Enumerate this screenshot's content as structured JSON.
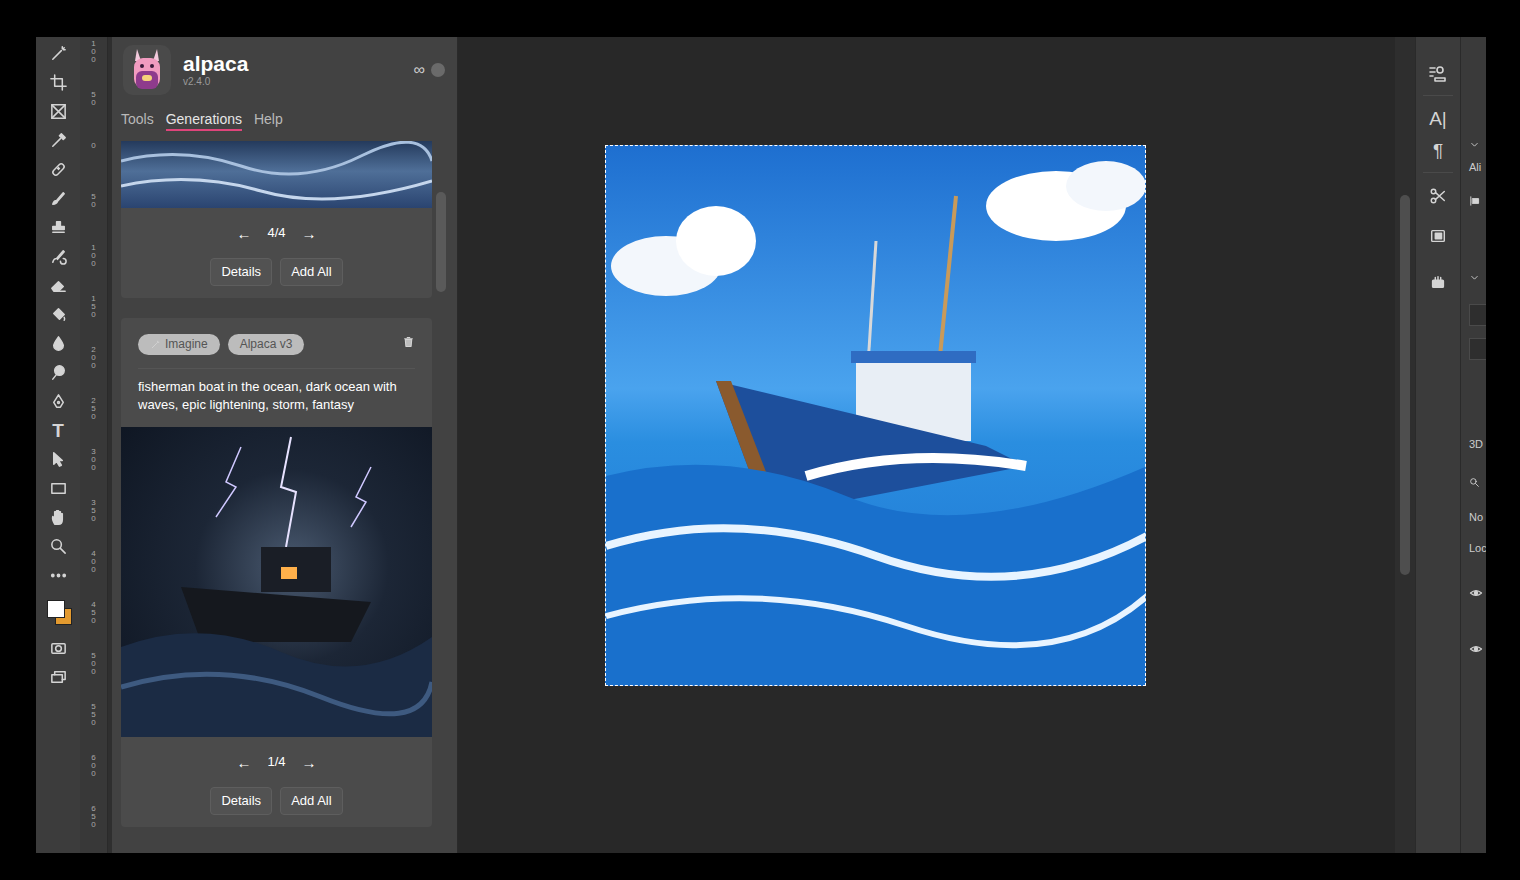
{
  "plugin": {
    "name": "alpaca",
    "version": "v2.4.0",
    "link_icon": "∞"
  },
  "tabs": [
    {
      "label": "Tools",
      "selected": false
    },
    {
      "label": "Generations",
      "selected": true
    },
    {
      "label": "Help",
      "selected": false
    }
  ],
  "generations": [
    {
      "tags": [],
      "prompt": "",
      "prev": "←",
      "counter": "4/4",
      "next": "→",
      "buttons": [
        "Details",
        "Add All"
      ],
      "image": "ocean"
    },
    {
      "tags": [
        "Imagine",
        "Alpaca v3"
      ],
      "prompt": "fisherman boat in the ocean, dark ocean with waves, epic lightening, storm, fantasy",
      "prev": "←",
      "counter": "1/4",
      "next": "→",
      "buttons": [
        "Details",
        "Add All"
      ],
      "image": "storm"
    }
  ],
  "ruler": {
    "ticks": [
      "100",
      "50",
      "0",
      "50",
      "100",
      "150",
      "200",
      "250",
      "300",
      "350",
      "400",
      "450",
      "500",
      "550",
      "600",
      "650"
    ]
  },
  "toolbar": {
    "tools": [
      {
        "kind": "wand"
      },
      {
        "kind": "crop"
      },
      {
        "kind": "frame"
      },
      {
        "kind": "eyedropper"
      },
      {
        "kind": "healing"
      },
      {
        "kind": "brush"
      },
      {
        "kind": "stamp"
      },
      {
        "kind": "history"
      },
      {
        "kind": "eraser"
      },
      {
        "kind": "bucket"
      },
      {
        "kind": "drop"
      },
      {
        "kind": "dodge"
      },
      {
        "kind": "pen"
      },
      {
        "kind": "type",
        "label": "T"
      },
      {
        "kind": "select"
      },
      {
        "kind": "rect"
      },
      {
        "kind": "hand"
      },
      {
        "kind": "zoom"
      },
      {
        "kind": "more"
      }
    ],
    "foreground": "#ffffff",
    "background": "#e39a2f"
  },
  "right_panel": {
    "glyphs": [
      "A|",
      "¶"
    ],
    "labels": [
      "Ali",
      "3D",
      "No",
      "Loc"
    ]
  }
}
